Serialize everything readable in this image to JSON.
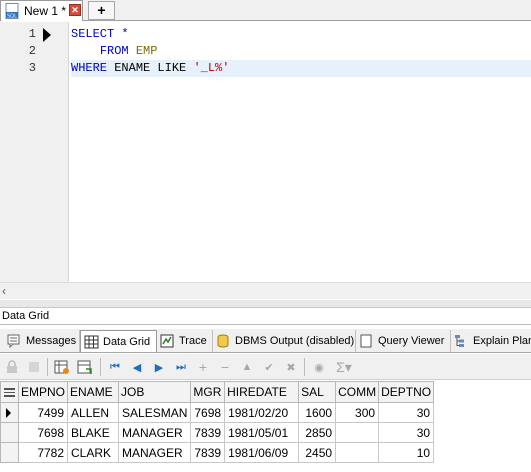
{
  "tab": {
    "label": "New 1 *",
    "close": "✕",
    "add": "+"
  },
  "editor": {
    "line_numbers": [
      "1",
      "2",
      "3"
    ],
    "lines": [
      {
        "kw1": "SELECT",
        "rest": " *"
      },
      {
        "indent": "    ",
        "kw1": "FROM",
        "space": " ",
        "ident": "EMP"
      },
      {
        "kw1": "WHERE",
        "plain": " ENAME LIKE ",
        "str": "'_L%'"
      }
    ]
  },
  "panel": {
    "title": "Data Grid"
  },
  "bottom_tabs": [
    {
      "label": "Messages",
      "icon": "messages-icon"
    },
    {
      "label": "Data Grid",
      "icon": "data-grid-icon"
    },
    {
      "label": "Trace",
      "icon": "trace-icon"
    },
    {
      "label": "DBMS Output (disabled)",
      "icon": "dbms-output-icon"
    },
    {
      "label": "Query Viewer",
      "icon": "query-viewer-icon"
    },
    {
      "label": "Explain Plan",
      "icon": "explain-plan-icon"
    }
  ],
  "grid": {
    "columns": [
      "EMPNO",
      "ENAME",
      "JOB",
      "MGR",
      "HIREDATE",
      "SAL",
      "COMM",
      "DEPTNO"
    ],
    "rows": [
      [
        "7499",
        "ALLEN",
        "SALESMAN",
        "7698",
        "1981/02/20",
        "1600",
        "300",
        "30"
      ],
      [
        "7698",
        "BLAKE",
        "MANAGER",
        "7839",
        "1981/05/01",
        "2850",
        "",
        "30"
      ],
      [
        "7782",
        "CLARK",
        "MANAGER",
        "7839",
        "1981/06/09",
        "2450",
        "",
        "10"
      ]
    ]
  },
  "colors": {
    "keyword": "#0000c8",
    "identifier": "#7a6a00",
    "string": "#c00000",
    "current_line": "#e6f1fc"
  }
}
